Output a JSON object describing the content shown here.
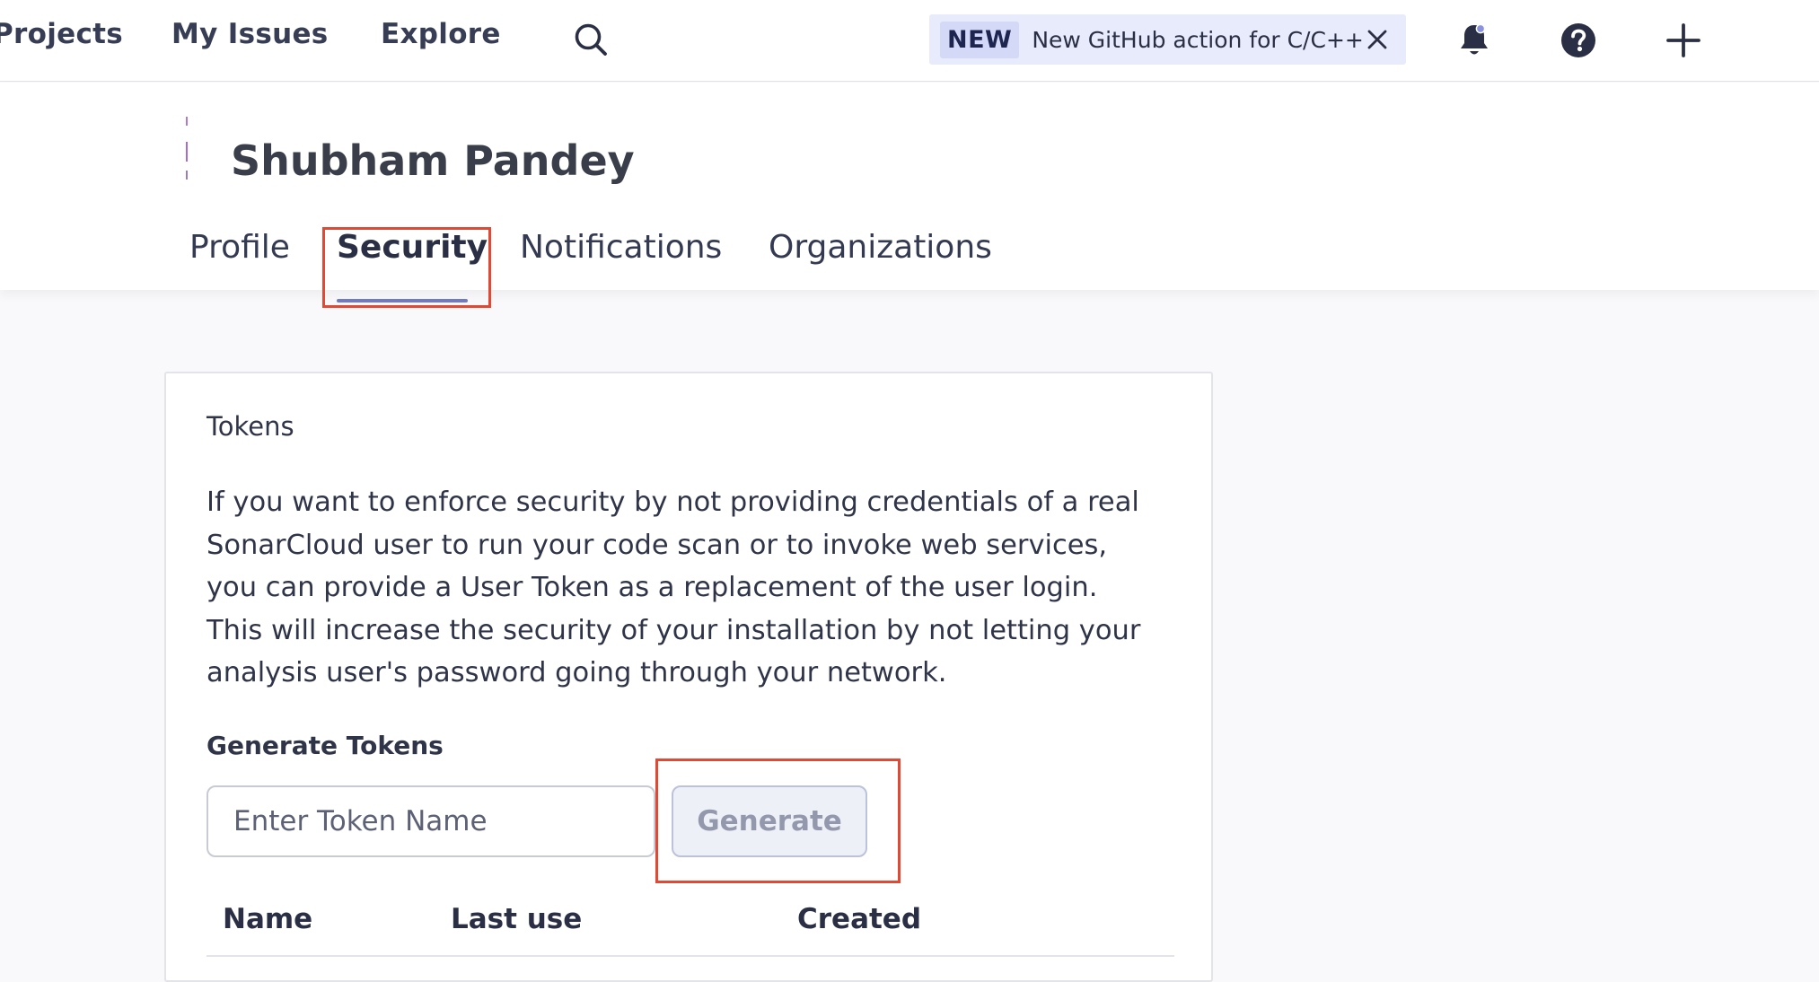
{
  "nav": {
    "projects": "Projects",
    "my_issues": "My Issues",
    "explore": "Explore"
  },
  "announcement": {
    "badge": "NEW",
    "text": "New GitHub action for C/C++"
  },
  "icons": {
    "search": "search-icon",
    "close": "close-icon",
    "bell": "bell-icon",
    "help": "help-icon",
    "plus": "plus-icon"
  },
  "user": {
    "name": "Shubham Pandey"
  },
  "tabs": [
    {
      "label": "Profile"
    },
    {
      "label": "Security",
      "active": true
    },
    {
      "label": "Notifications"
    },
    {
      "label": "Organizations"
    }
  ],
  "tokens": {
    "title": "Tokens",
    "description": "If you want to enforce security by not providing credentials of a real SonarCloud user to run your code scan or to invoke web services, you can provide a User Token as a replacement of the user login. This will increase the security of your installation by not letting your analysis user's password going through your network.",
    "generate_label": "Generate Tokens",
    "input_value": "",
    "input_placeholder": "Enter Token Name",
    "generate_button": "Generate",
    "columns": [
      "Name",
      "Last use",
      "Created"
    ]
  },
  "colors": {
    "accent": "#7179c4",
    "highlight_red": "#e04a35",
    "announcement_bg": "#e8ebfb"
  }
}
